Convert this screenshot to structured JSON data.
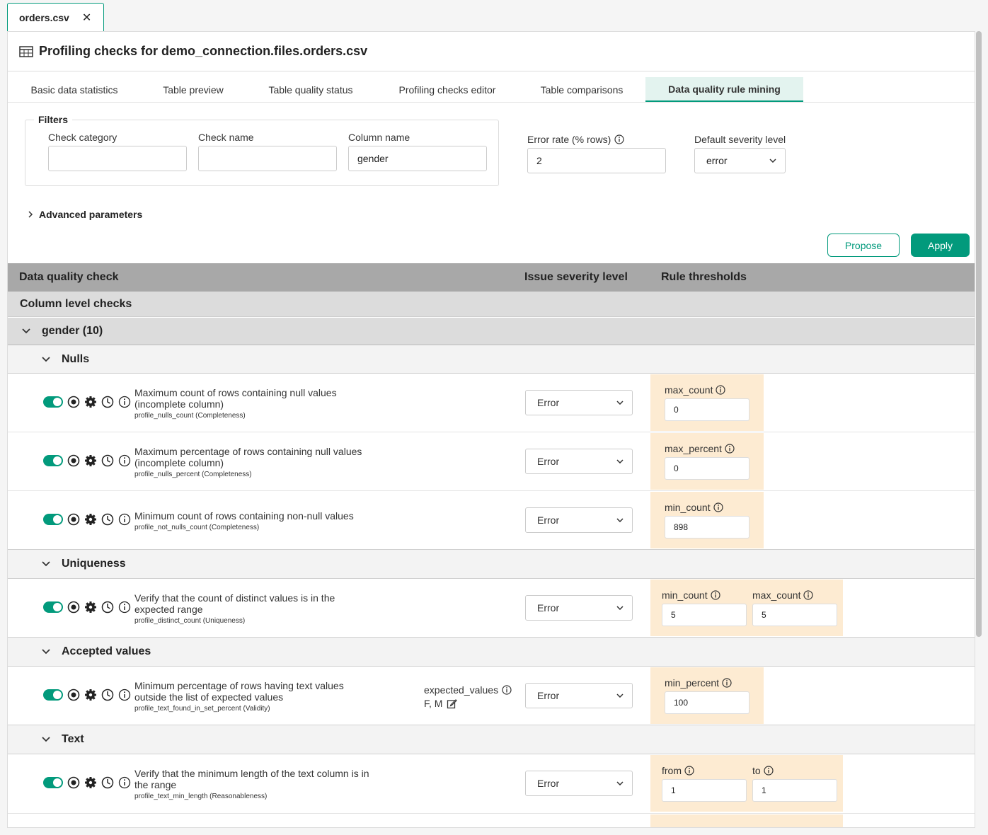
{
  "file_tab": {
    "name": "orders.csv",
    "close": "✕"
  },
  "header": {
    "title": "Profiling checks for demo_connection.files.orders.csv",
    "icon": "table-icon"
  },
  "tabs": [
    {
      "label": "Basic data statistics"
    },
    {
      "label": "Table preview"
    },
    {
      "label": "Table quality status"
    },
    {
      "label": "Profiling checks editor"
    },
    {
      "label": "Table comparisons"
    },
    {
      "label": "Data quality rule mining",
      "active": true
    }
  ],
  "filters": {
    "legend": "Filters",
    "check_category": {
      "label": "Check category",
      "value": ""
    },
    "check_name": {
      "label": "Check name",
      "value": ""
    },
    "column_name": {
      "label": "Column name",
      "value": "gender"
    },
    "error_rate": {
      "label": "Error rate (% rows)",
      "value": "2"
    },
    "default_severity": {
      "label": "Default severity level",
      "value": "error"
    }
  },
  "advanced": {
    "label": "Advanced parameters"
  },
  "buttons": {
    "propose": "Propose",
    "apply": "Apply"
  },
  "grid_header": {
    "check": "Data quality check",
    "severity": "Issue severity level",
    "thresholds": "Rule thresholds"
  },
  "column_level": "Column level checks",
  "group": "gender (10)",
  "categories": {
    "nulls": "Nulls",
    "uniqueness": "Uniqueness",
    "accepted": "Accepted values",
    "text": "Text"
  },
  "rows": [
    {
      "title": "Maximum count of rows containing null values (incomplete column)",
      "name": "profile_nulls_count (Completeness)",
      "severity": "Error",
      "thresholds": [
        {
          "label": "max_count",
          "value": "0"
        }
      ]
    },
    {
      "title": "Maximum percentage of rows containing null values (incomplete column)",
      "name": "profile_nulls_percent (Completeness)",
      "severity": "Error",
      "thresholds": [
        {
          "label": "max_percent",
          "value": "0"
        }
      ]
    },
    {
      "title": "Minimum count of rows containing non-null values",
      "name": "profile_not_nulls_count (Completeness)",
      "severity": "Error",
      "thresholds": [
        {
          "label": "min_count",
          "value": "898"
        }
      ]
    },
    {
      "title": "Verify that the count of distinct values is in the expected range",
      "name": "profile_distinct_count (Uniqueness)",
      "severity": "Error",
      "thresholds": [
        {
          "label": "min_count",
          "value": "5"
        },
        {
          "label": "max_count",
          "value": "5"
        }
      ]
    },
    {
      "title": "Minimum percentage of rows having text values outside the list of expected values",
      "name": "profile_text_found_in_set_percent (Validity)",
      "severity": "Error",
      "expected_label": "expected_values",
      "expected_value": "F, M",
      "thresholds": [
        {
          "label": "min_percent",
          "value": "100"
        }
      ]
    },
    {
      "title": "Verify that the minimum length of the text column is in the range",
      "name": "profile_text_min_length (Reasonableness)",
      "severity": "Error",
      "thresholds": [
        {
          "label": "from",
          "value": "1"
        },
        {
          "label": "to",
          "value": "1"
        }
      ]
    }
  ]
}
